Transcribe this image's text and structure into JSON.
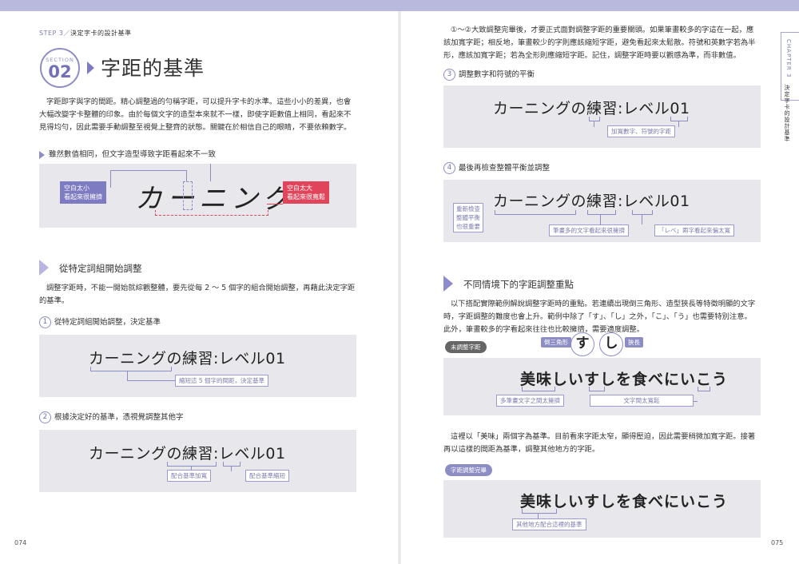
{
  "left": {
    "step_label": "STEP 3",
    "step_slash": "／",
    "step_title": "決定字卡的設計基準",
    "section_word": "SECTION",
    "section_num": "02",
    "title": "字距的基準",
    "intro": [
      "字距即字與字的間距。精心調整過的勻稱字距，可以提升字卡的水準。這些小小的差異，也會",
      "大幅改變字卡整體的印象。由於每個文字的造型本來就不一樣，即使字距數值上相同，看起來不",
      "見得均勻，因此需要手動調整至視覺上整齊的狀態。關鍵在於相信自己的眼睛，不要依賴數字。"
    ],
    "bullet": "雖然數值相同，但文字造型導致字距看起來不一致",
    "fig1": {
      "left_note_line1": "空白太小",
      "left_note_line2": "看起來很擁擠",
      "word": "カーニング",
      "right_note_line1": "空白太大",
      "right_note_line2": "看起來很寬鬆"
    },
    "heading": "從特定詞組開始調整",
    "para2": [
      "調整字距時，不能一開始就綜觀整體，要先從每 2 ～ 5 個字的組合開始調整，再藉此決定字距",
      "的基準。"
    ],
    "step1_num": "1",
    "step1": "從特定詞組開始調整，決定基準",
    "sample1": "カーニングの練習:レベル01",
    "note1": "縮短這 5 個字的間距，決定基準",
    "step2_num": "2",
    "step2": "根據決定好的基準，憑視覺調整其他字",
    "sample2": "カーニングの練習:レベル01",
    "note2a": "配合基準加寬",
    "note2b": "配合基準縮短",
    "page_no": "074"
  },
  "right": {
    "para1": [
      "①～②大致調整完畢後，才要正式面對調整字距的重要關頭。如果筆畫較多的字這在一起，應",
      "該加寬字距；相反地，筆畫較少的字則應該縮短字距，避免看起來太鬆散。符號和英數字若為半",
      "形，應該加寬字距；若為全形則應縮短字距。記住，調整字距時要以觀感為準，而非數值。"
    ],
    "step3_num": "3",
    "step3": "調整數字和符號的平衡",
    "sample3": "カーニングの練習:レベル01",
    "note3": "加寬數字、符號的字距",
    "step4_num": "4",
    "step4": "最後再檢查整體平衡並調整",
    "sample4": "カーニングの練習:レベル01",
    "note4a_l1": "重新檢查",
    "note4a_l2": "整體平衡",
    "note4a_l3": "也很重要",
    "note4b": "筆畫多的文字看起來很擁擠",
    "note4c": "「レベ」兩字看起來偏太寬",
    "heading": "不同情境下的字距調整重點",
    "para2": [
      "以下搭配實際範例解說調整字距時的重點。若連續出現倒三角形、造型狹長等特徵明顯的文字",
      "時，字距調整的難度也會上升。範例中除了「す」、「し」之外，「こ」、「う」也需要特別注意。",
      "此外，筆畫較多的字看起來往往也比較擁擠，需要適度調整。"
    ],
    "callout_left": "倒三角形",
    "callout_char1": "す",
    "callout_char2": "し",
    "callout_right": "狹長",
    "tag1": "未調整字距",
    "sample5": "美味しいすしを食べにいこう",
    "note5a": "多筆畫文字之間太擁擠",
    "note5b": "文字間太寬鬆",
    "para3": [
      "這裡以「美味」兩個字為基準。目前看來字距太窄，顯得壓迫，因此需要稍微加寬字距。接著",
      "再以這樣的間距為基準，調整其他地方的字距。"
    ],
    "tag2": "字距調整完畢",
    "sample6": "美味しいすしを食べにいこう",
    "note6": "其他地方配合這裡的基準",
    "side_chapter": "CHAPTER 3",
    "side_title": "決定字卡的設計基準",
    "page_no": "075"
  }
}
